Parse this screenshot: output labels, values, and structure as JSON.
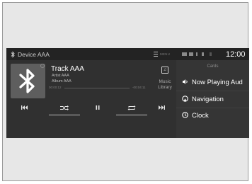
{
  "header": {
    "device_name": "Device AAA",
    "menu_label": "MENU",
    "clock": "12:00"
  },
  "now_playing": {
    "track": "Track AAA",
    "artist": "Artist AAA",
    "album": "Album AAA",
    "elapsed": "00:00:12",
    "remaining": "-00:04:11"
  },
  "library": {
    "label_line1": "Music",
    "label_line2": "Library",
    "icon_glyph": "♫"
  },
  "controls": [
    "skip-back-icon",
    "shuffle-icon",
    "pause-icon",
    "repeat-icon",
    "skip-forward-icon"
  ],
  "cards": {
    "title": "Cards",
    "items": [
      {
        "label": "Now Playing Aud",
        "icon": "volume-icon"
      },
      {
        "label": "Navigation",
        "icon": "navigation-icon"
      },
      {
        "label": "Clock",
        "icon": "clock-icon"
      }
    ]
  },
  "colors": {
    "screen_bg": "#2e2e2e",
    "panel_right": "#353535",
    "text_primary": "#ffffff"
  }
}
